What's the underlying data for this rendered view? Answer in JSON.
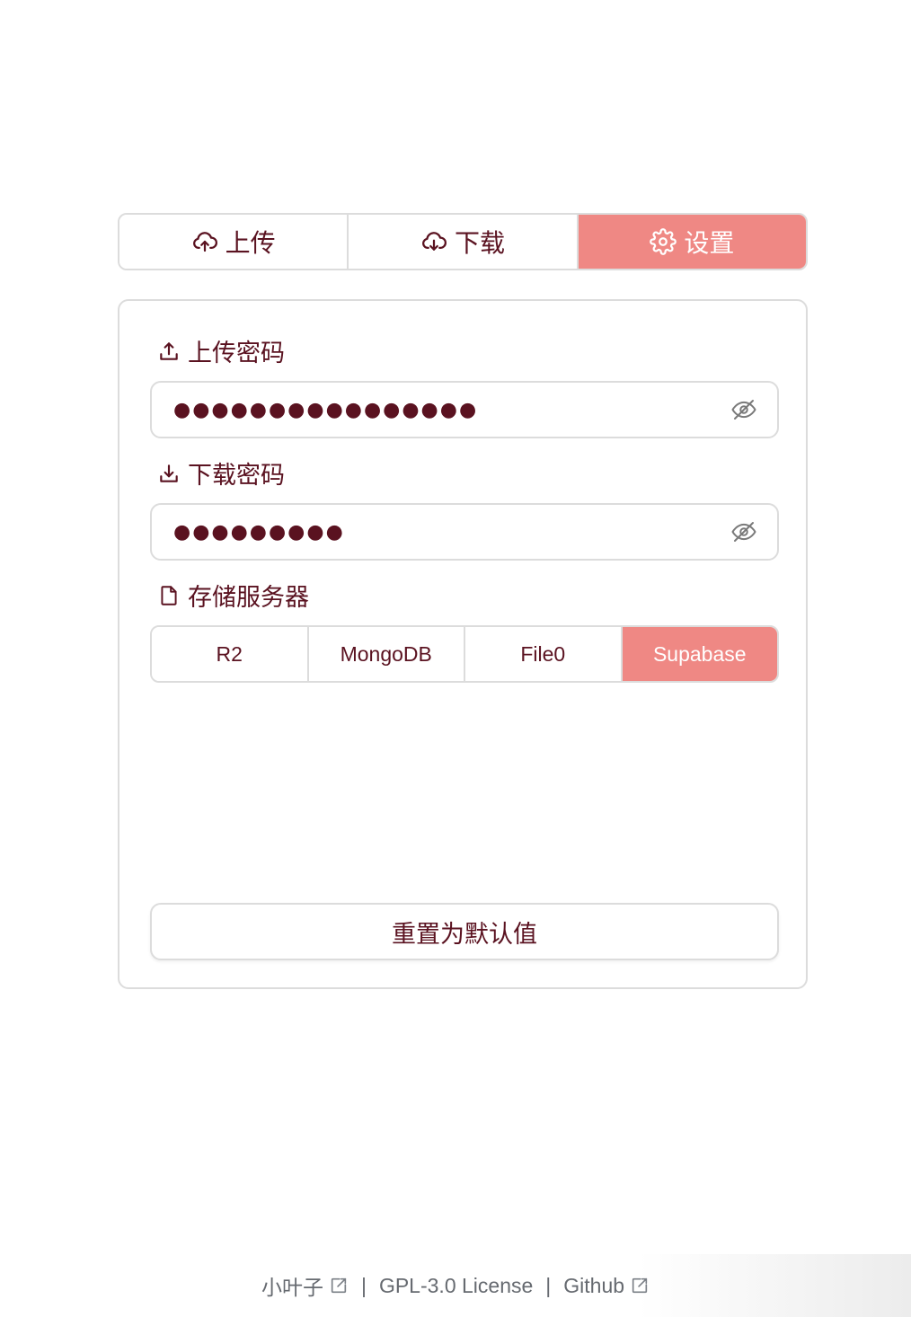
{
  "tabs": [
    {
      "label": "上传",
      "icon": "cloud-upload-icon",
      "active": false
    },
    {
      "label": "下载",
      "icon": "cloud-download-icon",
      "active": false
    },
    {
      "label": "设置",
      "icon": "gear-icon",
      "active": true
    }
  ],
  "settings": {
    "upload_password": {
      "label": "上传密码",
      "icon": "upload-icon",
      "value": "●●●●●●●●●●●●●●●●",
      "toggle_icon": "eye-slash-icon"
    },
    "download_password": {
      "label": "下载密码",
      "icon": "download-icon",
      "value": "●●●●●●●●●",
      "toggle_icon": "eye-slash-icon"
    },
    "storage": {
      "label": "存储服务器",
      "icon": "file-icon",
      "options": [
        "R2",
        "MongoDB",
        "File0",
        "Supabase"
      ],
      "selected": "Supabase"
    },
    "reset_label": "重置为默认值"
  },
  "footer": {
    "author": "小叶子",
    "separator": "|",
    "license": "GPL-3.0 License",
    "github": "Github"
  },
  "colors": {
    "accent": "#ef8884",
    "text": "#5a1220",
    "border": "#dcdcdc",
    "footer_text": "#666a70"
  }
}
